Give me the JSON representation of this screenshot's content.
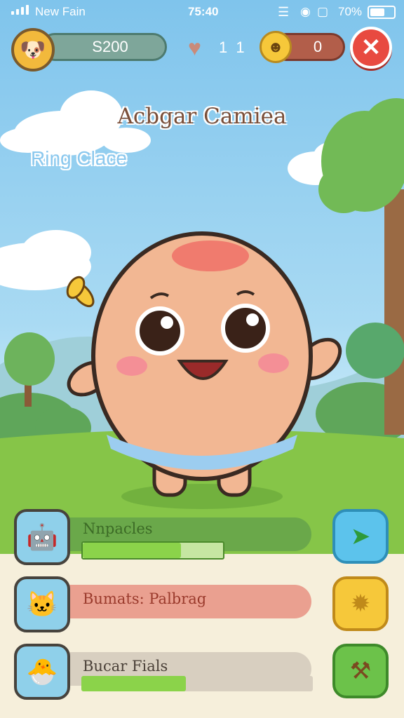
{
  "status_bar": {
    "carrier": "New Fain",
    "time": "75:40",
    "battery": "70%",
    "battery_level": 0.7
  },
  "hud": {
    "coins": "S200",
    "hearts": "1 1",
    "mood_value": "0"
  },
  "header": {
    "title": "Acbgar Camiea",
    "subtitle": "Ring Clace"
  },
  "tasks": [
    {
      "label": "Nnpacles",
      "progress": 0.7,
      "icon": "robot-icon",
      "button_icon": "arrow-icon"
    },
    {
      "label": "Bumats: Palbrag",
      "progress": null,
      "icon": "cat-icon",
      "button_icon": "sun-icon"
    },
    {
      "label": "Bucar Fials",
      "progress": 0.45,
      "icon": "bird-icon",
      "button_icon": "tool-icon"
    }
  ],
  "colors": {
    "sky": "#7fc4ec",
    "grass": "#86c548",
    "accent_red": "#e84a40",
    "panel_bg": "#f6efdb",
    "progress_green": "#8bd34a"
  }
}
